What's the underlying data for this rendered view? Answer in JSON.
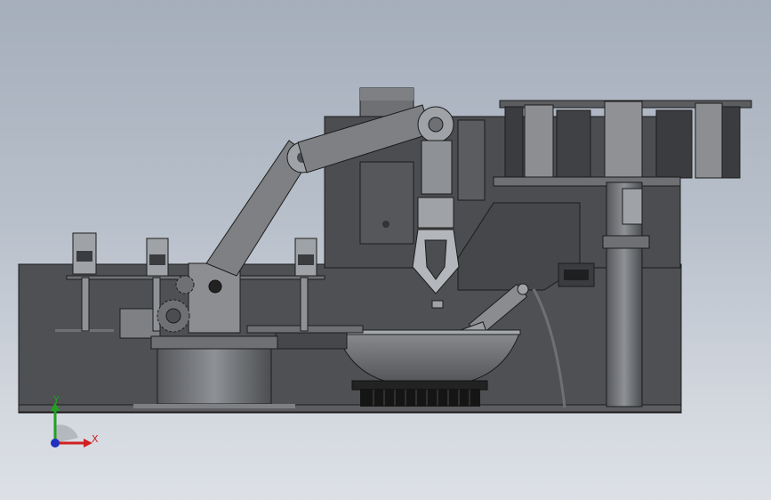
{
  "scene": {
    "background_top": "#a5aebb",
    "background_bottom": "#dde1e6",
    "model_dark": "#4d4f52",
    "model_mid": "#6e7074",
    "model_light": "#9fa2a6",
    "edge": "#1c1c1c"
  },
  "triad": {
    "x_label": "X",
    "y_label": "Y",
    "x_color": "#d02020",
    "y_color": "#22a022",
    "z_color": "#2030c0",
    "icon": "coordinate-triad-icon"
  }
}
